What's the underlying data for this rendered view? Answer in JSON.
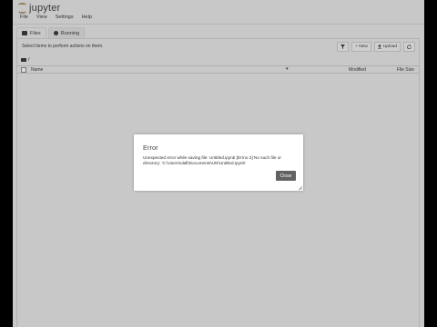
{
  "app": {
    "logo_text": "jupyter"
  },
  "menu": [
    "File",
    "View",
    "Settings",
    "Help"
  ],
  "tabs": [
    {
      "label": "Files",
      "icon": "folder-icon"
    },
    {
      "label": "Running",
      "icon": "stop-icon"
    }
  ],
  "toolbar": {
    "hint": "Select items to perform actions on them.",
    "new_label": "+ New",
    "upload_label": "Upload"
  },
  "breadcrumb": {
    "path": "/"
  },
  "list": {
    "col_name": "Name",
    "col_modified": "Modified",
    "col_size": "File Size"
  },
  "dialog": {
    "title": "Error",
    "message": "Unexpected error while saving file: Untitled.ipynb [Errno 2] No such file or directory: 'C:\\Users\\ulall\\Documents\\UN\\Untitled.ipynb'",
    "close_label": "Close"
  }
}
